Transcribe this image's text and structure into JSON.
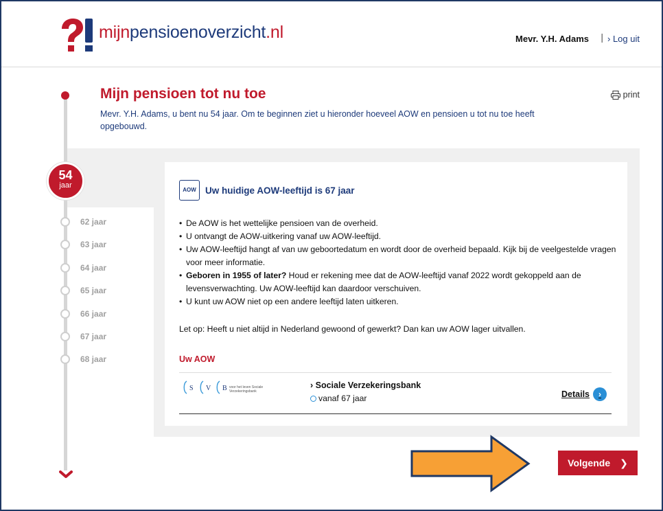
{
  "header": {
    "logo_mijn": "mijn",
    "logo_main": "pensioenoverzicht",
    "logo_tld": ".nl",
    "user_name": "Mevr. Y.H. Adams",
    "separator": "|",
    "logout_label": "› Log uit"
  },
  "page": {
    "title": "Mijn pensioen tot nu toe",
    "intro": "Mevr. Y.H. Adams, u bent nu 54 jaar. Om te beginnen ziet u hieronder hoeveel AOW en pensioen u tot nu toe heeft opgebouwd.",
    "print_label": "print"
  },
  "timeline": {
    "current_age": "54",
    "current_unit": "jaar",
    "items": [
      "62 jaar",
      "63 jaar",
      "64 jaar",
      "65 jaar",
      "66 jaar",
      "67 jaar",
      "68 jaar"
    ]
  },
  "card": {
    "badge": "AOW",
    "title": "Uw huidige AOW-leeftijd is 67 jaar",
    "bullets": [
      {
        "bold": "",
        "text": "De AOW is het wettelijke pensioen van de overheid."
      },
      {
        "bold": "",
        "text": "U ontvangt de AOW-uitkering vanaf uw AOW-leeftijd."
      },
      {
        "bold": "",
        "text": "Uw AOW-leeftijd hangt af van uw geboortedatum en wordt door de overheid bepaald. Kijk bij de veelgestelde vragen voor meer informatie."
      },
      {
        "bold": "Geboren in 1955 of later?",
        "text": " Houd er rekening mee dat de AOW-leeftijd vanaf 2022 wordt gekoppeld aan de levensverwachting. Uw AOW-leeftijd kan daardoor verschuiven."
      },
      {
        "bold": "",
        "text": "U kunt uw AOW niet op een andere leeftijd laten uitkeren."
      }
    ],
    "note": "Let op: Heeft u niet altijd in Nederland gewoond of gewerkt? Dan kan uw AOW lager uitvallen.",
    "section_heading": "Uw AOW",
    "provider": {
      "logo_letters": [
        "S",
        "V",
        "B"
      ],
      "logo_subtext": "voor het leven Sociale Verzekeringsbank",
      "name": "› Sociale Verzekeringsbank",
      "since": "vanaf 67 jaar",
      "details_label": "Details",
      "details_icon": "›"
    }
  },
  "navigation": {
    "next_label": "Volgende",
    "next_icon": "❯"
  },
  "colors": {
    "brand_red": "#c01a2c",
    "brand_blue": "#1d3a7a",
    "accent_blue": "#2a8fd6",
    "annotation_orange": "#f7a035"
  }
}
